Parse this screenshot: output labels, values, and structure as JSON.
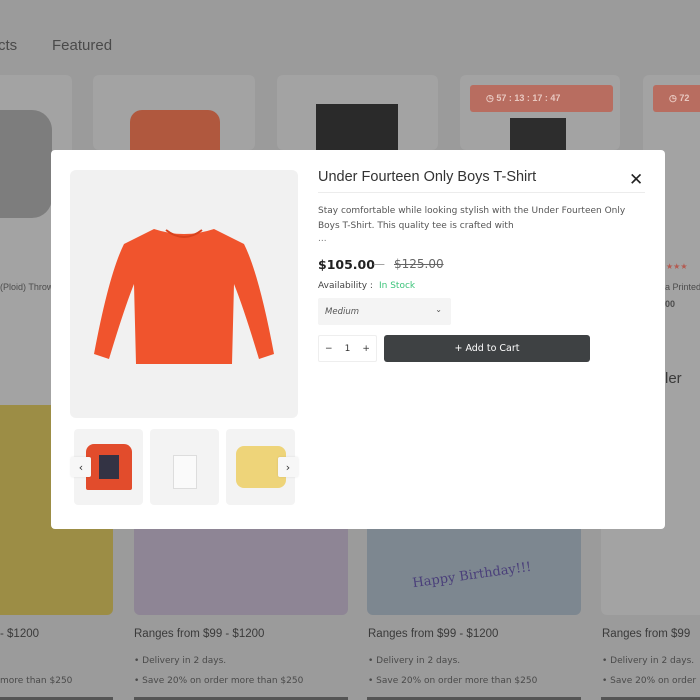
{
  "background": {
    "tabs": [
      "cts",
      "Featured"
    ],
    "timers": [
      "57 : 13 : 17 : 47",
      "72"
    ],
    "product_texts": [
      "(Ploid) Throw",
      "a Printed",
      "00",
      "ler"
    ],
    "ranges": [
      "- $1200",
      "Ranges from $99 - $1200",
      "Ranges from $99 - $1200",
      "Ranges from $99"
    ],
    "delivery": "Delivery in 2 days.",
    "save": "Save 20% on order more than $250",
    "save_partial": "more than $250",
    "save_partial_right": "Save 20% on order",
    "birthday_text": "Happy Birthday!!!"
  },
  "modal": {
    "title": "Under Fourteen Only Boys T-Shirt",
    "close_icon": "close-icon",
    "description": "Stay comfortable while looking stylish with the Under Fourteen Only Boys T-Shirt. This quality tee is crafted with",
    "ellipsis": "...",
    "price": "$105.00",
    "price_separator": "—",
    "old_price": "$125.00",
    "availability_label": "Availability :",
    "availability_value": "In Stock",
    "size_select": "Medium",
    "quantity": "1",
    "qty_minus": "−",
    "qty_plus": "+",
    "add_to_cart": "+ Add to Cart",
    "prev_icon": "‹",
    "next_icon": "›",
    "colors": {
      "product": "#f0542d",
      "stock": "#3cc37a",
      "button": "#3e4143"
    }
  }
}
